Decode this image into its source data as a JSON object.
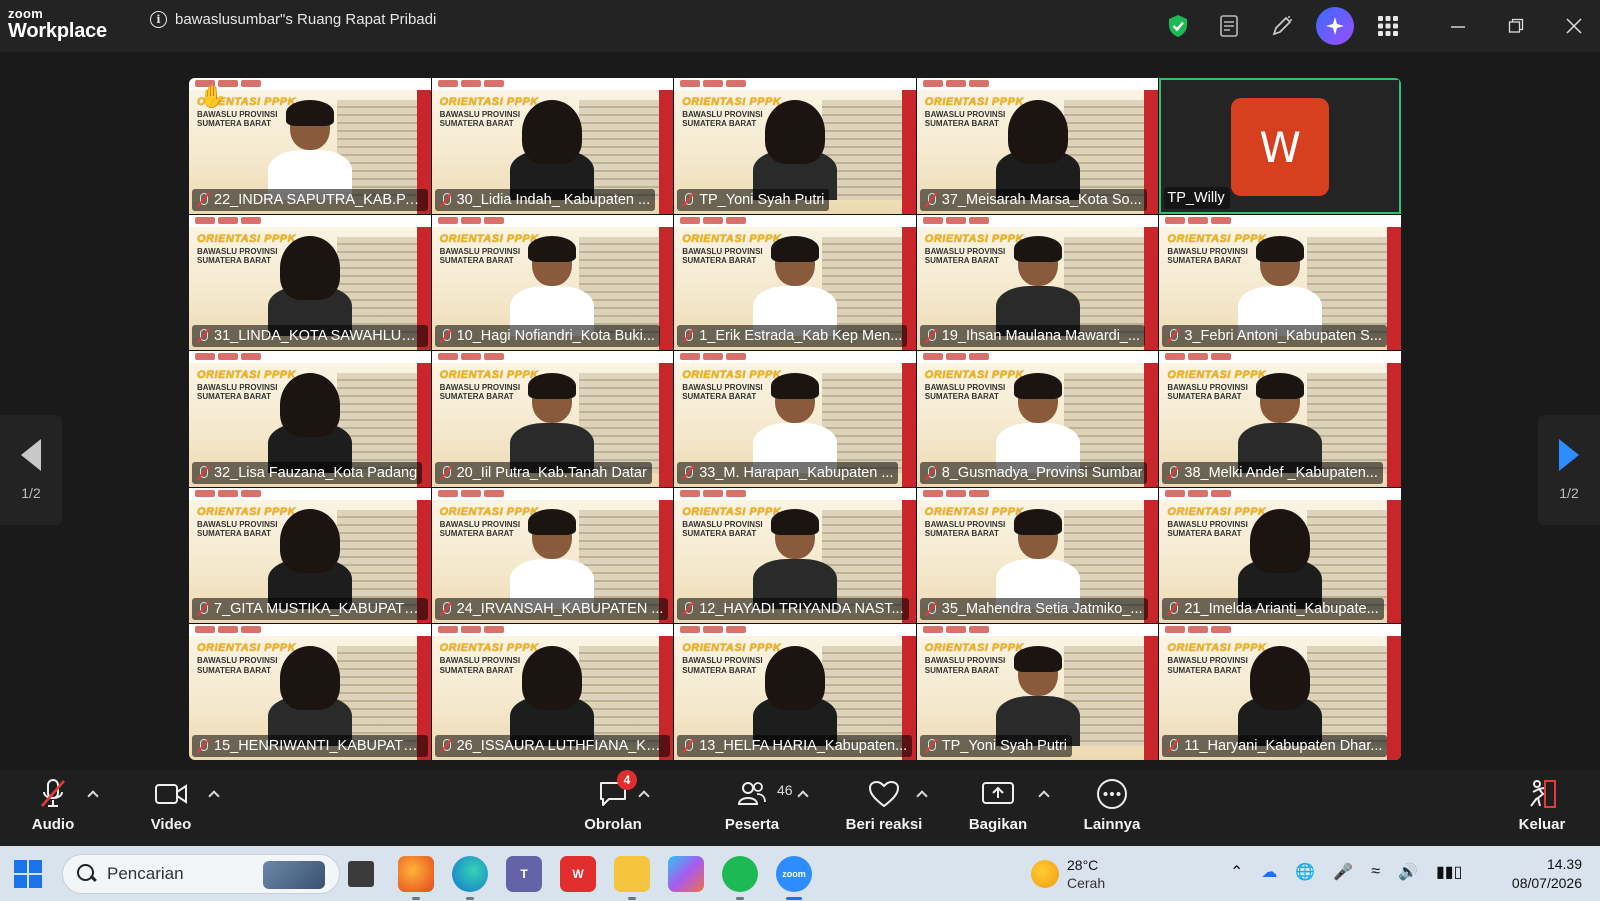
{
  "app": {
    "brand_top": "zoom",
    "brand_bottom": "Workplace"
  },
  "meeting": {
    "title": "bawaslusumbar\"s Ruang Rapat Pribadi",
    "info_icon": "info-icon"
  },
  "titlebar_icons": [
    "shield-check-icon",
    "notes-icon",
    "whiteboard-pen-icon",
    "ai-companion-icon",
    "apps-grid-icon",
    "minimize-icon",
    "restore-icon",
    "close-icon"
  ],
  "colors": {
    "accent": "#2d8cff",
    "active_speaker_border": "#2ec46b",
    "mute_red": "#e5393a",
    "avatar_bg": "#d7401f",
    "shield_green": "#1db954"
  },
  "slide_text": {
    "line1": "ORIENTASI PPPK",
    "line2": "BAWASLU PROVINSI",
    "line3": "SUMATERA BARAT"
  },
  "participants": [
    {
      "name": "22_INDRA SAPUTRA_KAB.PA...",
      "muted": true,
      "hand_raised": true
    },
    {
      "name": "30_Lidia Indah_ Kabupaten ...",
      "muted": true
    },
    {
      "name": "TP_Yoni Syah Putri",
      "muted": true
    },
    {
      "name": "37_Meisarah Marsa_Kota So...",
      "muted": true
    },
    {
      "name": "TP_Willy",
      "muted": false,
      "avatar_letter": "W",
      "active_speaker": true
    },
    {
      "name": "31_LINDA_KOTA SAWAHLUN...",
      "muted": true
    },
    {
      "name": "10_Hagi Nofiandri_Kota Buki...",
      "muted": true
    },
    {
      "name": "1_Erik Estrada_Kab Kep Men...",
      "muted": true
    },
    {
      "name": "19_Ihsan Maulana Mawardi_...",
      "muted": true
    },
    {
      "name": "3_Febri Antoni_Kabupaten S...",
      "muted": true
    },
    {
      "name": "32_Lisa Fauzana_Kota Padang",
      "muted": true
    },
    {
      "name": "20_Iil Putra_Kab.Tanah Datar",
      "muted": true
    },
    {
      "name": "33_M. Harapan_Kabupaten ...",
      "muted": true
    },
    {
      "name": "8_Gusmadya_Provinsi Sumbar",
      "muted": true
    },
    {
      "name": "38_Melki Andef _Kabupaten...",
      "muted": true
    },
    {
      "name": "7_GITA MUSTIKA_KABUPATE...",
      "muted": true
    },
    {
      "name": "24_IRVANSAH_KABUPATEN ...",
      "muted": true
    },
    {
      "name": "12_HAYADI TRIYANDA NAST...",
      "muted": true
    },
    {
      "name": "35_Mahendra Setia Jatmiko_...",
      "muted": true
    },
    {
      "name": "21_Imelda Arianti_Kabupate...",
      "muted": true
    },
    {
      "name": "15_HENRIWANTI_KABUPATE...",
      "muted": true
    },
    {
      "name": "26_ISSAURA LUTHFIANA_KO...",
      "muted": true
    },
    {
      "name": "13_HELFA HARIA_Kabupaten...",
      "muted": true
    },
    {
      "name": "TP_Yoni Syah Putri",
      "muted": true
    },
    {
      "name": "11_Haryani_Kabupaten Dhar...",
      "muted": true
    }
  ],
  "pager": {
    "left_label": "1/2",
    "right_label": "1/2"
  },
  "toolbar": {
    "audio": "Audio",
    "video": "Video",
    "chat": "Obrolan",
    "chat_badge": "4",
    "participants": "Peserta",
    "participants_count": "46",
    "reactions": "Beri reaksi",
    "share": "Bagikan",
    "more": "Lainnya",
    "leave": "Keluar"
  },
  "taskbar": {
    "search_placeholder": "Pencarian",
    "weather_temp": "28°C",
    "weather_desc": "Cerah",
    "time": "14.39",
    "date": "08/07/2026",
    "apps": [
      "task-view-icon",
      "firefox-icon",
      "edge-icon",
      "teams-icon",
      "wps-office-icon",
      "file-explorer-icon",
      "copilot-icon",
      "spotify-icon",
      "zoom-icon"
    ],
    "tray_icons": [
      "chevron-up-icon",
      "onedrive-icon",
      "vpn-globe-icon",
      "microphone-icon",
      "wifi-icon",
      "volume-icon",
      "battery-icon"
    ]
  }
}
